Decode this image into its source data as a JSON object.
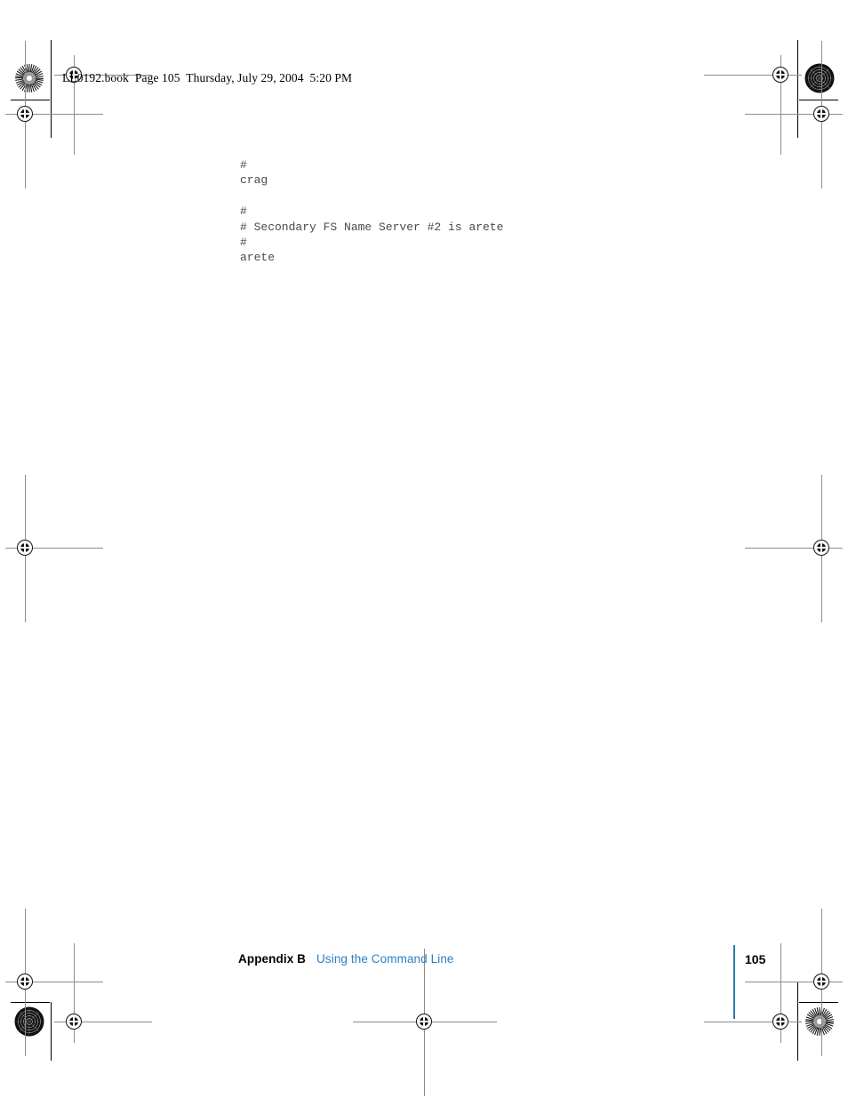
{
  "document": {
    "header_line": "LL0192.book  Page 105  Thursday, July 29, 2004  5:20 PM",
    "page_number": "105"
  },
  "code_block": {
    "lines": [
      "#",
      "crag",
      "",
      "#",
      "# Secondary FS Name Server #2 is arete",
      "#",
      "arete"
    ]
  },
  "footer": {
    "appendix_label": "Appendix B",
    "chapter_title": "Using the Command Line"
  },
  "colors": {
    "link_blue": "#2b7fc4",
    "rule_blue": "#2e7aa8",
    "code_gray": "#4a4a4a",
    "body_black": "#000000"
  },
  "print_marks": {
    "registration_icon": "registration-crosshair-icon",
    "rosette_icon": "rosette-star-target-icon"
  }
}
